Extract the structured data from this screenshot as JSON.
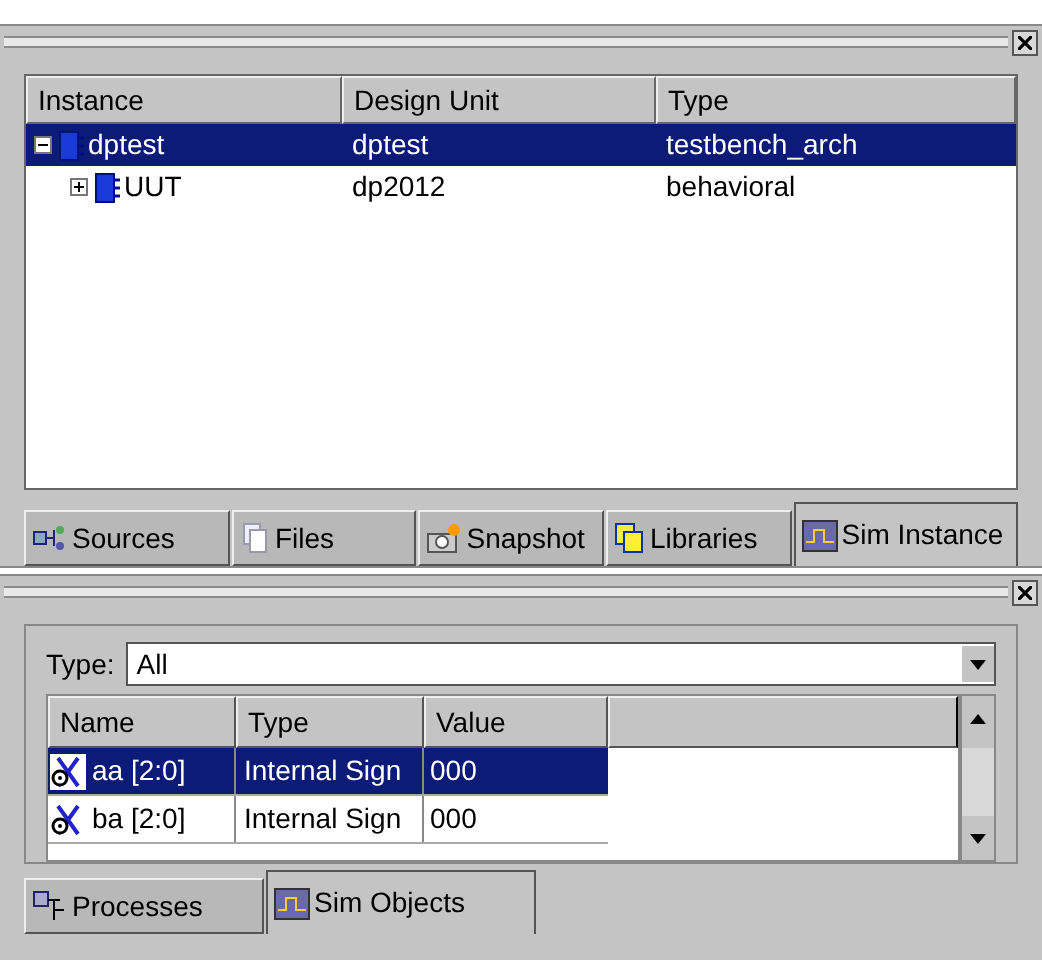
{
  "instance_panel": {
    "columns": [
      "Instance",
      "Design Unit",
      "Type"
    ],
    "rows": [
      {
        "instance": "dptest",
        "design_unit": "dptest",
        "type": "testbench_arch",
        "expanded": true,
        "selected": true,
        "children": [
          {
            "instance": "UUT",
            "design_unit": "dp2012",
            "type": "behavioral",
            "expanded": false,
            "selected": false
          }
        ]
      }
    ],
    "tabs": [
      {
        "label": "Sources",
        "kind": "sources",
        "selected": false
      },
      {
        "label": "Files",
        "kind": "files",
        "selected": false
      },
      {
        "label": "Snapshot",
        "kind": "snapshot",
        "selected": false
      },
      {
        "label": "Libraries",
        "kind": "libraries",
        "selected": false
      },
      {
        "label": "Sim Instance",
        "kind": "wave",
        "selected": true
      }
    ]
  },
  "objects_panel": {
    "filter": {
      "label": "Type:",
      "value": "All"
    },
    "columns": [
      "Name",
      "Type",
      "Value"
    ],
    "rows": [
      {
        "name": "aa [2:0]",
        "type": "Internal Sign",
        "value": "000",
        "selected": true
      },
      {
        "name": "ba [2:0]",
        "type": "Internal Sign",
        "value": "000",
        "selected": false
      }
    ],
    "tabs": [
      {
        "label": "Processes",
        "kind": "processes",
        "selected": false
      },
      {
        "label": "Sim Objects",
        "kind": "wave",
        "selected": true
      }
    ]
  }
}
